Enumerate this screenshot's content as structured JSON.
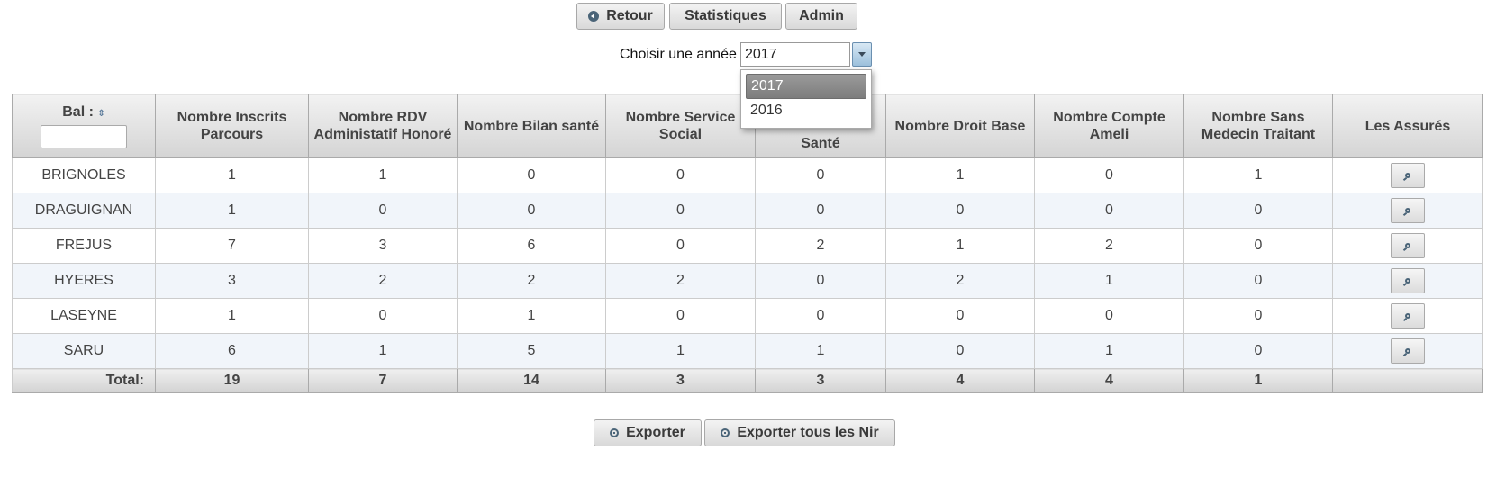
{
  "toolbar": {
    "retour_label": "Retour",
    "statistiques_label": "Statistiques",
    "admin_label": "Admin"
  },
  "year_select": {
    "label": "Choisir une année :",
    "value": "2017",
    "options": [
      "2017",
      "2016"
    ]
  },
  "table": {
    "headers": {
      "bal": "Bal :",
      "inscrits": "Nombre Inscrits Parcours",
      "rdv": "Nombre RDV Administatif Honoré",
      "bilan": "Nombre Bilan santé",
      "service": "Nombre Service Social",
      "hidden_part": "Santé",
      "droit": "Nombre Droit Base",
      "ameli": "Nombre Compte Ameli",
      "medecin": "Nombre Sans Medecin Traitant",
      "assures": "Les Assurés"
    },
    "rows": [
      {
        "bal": "BRIGNOLES",
        "values": [
          "1",
          "1",
          "0",
          "0",
          "0",
          "1",
          "0",
          "1"
        ]
      },
      {
        "bal": "DRAGUIGNAN",
        "values": [
          "1",
          "0",
          "0",
          "0",
          "0",
          "0",
          "0",
          "0"
        ]
      },
      {
        "bal": "FREJUS",
        "values": [
          "7",
          "3",
          "6",
          "0",
          "2",
          "1",
          "2",
          "0"
        ]
      },
      {
        "bal": "HYERES",
        "values": [
          "3",
          "2",
          "2",
          "2",
          "0",
          "2",
          "1",
          "0"
        ]
      },
      {
        "bal": "LASEYNE",
        "values": [
          "1",
          "0",
          "1",
          "0",
          "0",
          "0",
          "0",
          "0"
        ]
      },
      {
        "bal": "SARU",
        "values": [
          "6",
          "1",
          "5",
          "1",
          "1",
          "0",
          "1",
          "0"
        ]
      }
    ],
    "total": {
      "label": "Total:",
      "values": [
        "19",
        "7",
        "14",
        "3",
        "3",
        "4",
        "4",
        "1"
      ]
    }
  },
  "footer": {
    "exporter_label": "Exporter",
    "exporter_nir_label": "Exporter tous les Nir"
  }
}
